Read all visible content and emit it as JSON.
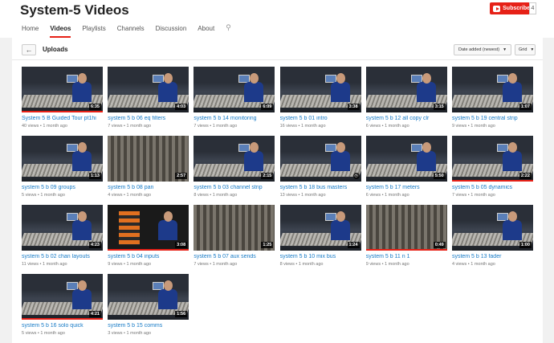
{
  "channel": {
    "title": "System-5 Videos",
    "subscribe_label": "Subscribe",
    "subscriber_count": "4"
  },
  "tabs": [
    {
      "label": "Home",
      "active": false
    },
    {
      "label": "Videos",
      "active": true
    },
    {
      "label": "Playlists",
      "active": false
    },
    {
      "label": "Channels",
      "active": false
    },
    {
      "label": "Discussion",
      "active": false
    },
    {
      "label": "About",
      "active": false
    }
  ],
  "toolbar": {
    "back_icon": "←",
    "section_title": "Uploads",
    "sort_label": "Date added (newest)",
    "view_label": "Grid"
  },
  "colors": {
    "accent": "#e62117",
    "link": "#167ac6"
  },
  "videos": [
    {
      "title": "System 5 B Guided Tour pt1hi",
      "views": "40 views",
      "age": "1 month ago",
      "duration": "6:35",
      "watched": 1.0,
      "style": "v1"
    },
    {
      "title": "system 5 b 06 eq filters",
      "views": "7 views",
      "age": "1 month ago",
      "duration": "4:03",
      "watched": 0,
      "style": "v1"
    },
    {
      "title": "system 5 b 14 monitoring",
      "views": "7 views",
      "age": "1 month ago",
      "duration": "6:09",
      "watched": 0,
      "style": "v1"
    },
    {
      "title": "system 5 b 01 intro",
      "views": "16 views",
      "age": "1 month ago",
      "duration": "3:38",
      "watched": 0,
      "style": "v1"
    },
    {
      "title": "system 5 b 12 all copy clr",
      "views": "6 views",
      "age": "1 month ago",
      "duration": "3:15",
      "watched": 0,
      "style": "v1"
    },
    {
      "title": "system 5 b 19 central strip",
      "views": "9 views",
      "age": "1 month ago",
      "duration": "1:07",
      "watched": 0,
      "style": "v1"
    },
    {
      "title": "system 5 b 09 groups",
      "views": "5 views",
      "age": "1 month ago",
      "duration": "1:13",
      "watched": 0,
      "style": "v1"
    },
    {
      "title": "system 5 b 08 pan",
      "views": "4 views",
      "age": "1 month ago",
      "duration": "2:57",
      "watched": 0,
      "style": "v2"
    },
    {
      "title": "system 5 b 03 channel strip",
      "views": "8 views",
      "age": "1 month ago",
      "duration": "2:15",
      "watched": 0,
      "style": "v1"
    },
    {
      "title": "system 5 b 18 bus masters",
      "views": "13 views",
      "age": "1 month ago",
      "duration": "",
      "watched": 0,
      "style": "v1"
    },
    {
      "title": "system 5 b 17 meters",
      "views": "6 views",
      "age": "1 month ago",
      "duration": "5:50",
      "watched": 0,
      "style": "v1"
    },
    {
      "title": "system 5 b 05 dynamics",
      "views": "7 views",
      "age": "1 month ago",
      "duration": "2:22",
      "watched": 1.0,
      "style": "v1"
    },
    {
      "title": "system 5 b 02 chan layouts",
      "views": "11 views",
      "age": "1 month ago",
      "duration": "4:23",
      "watched": 0,
      "style": "v1"
    },
    {
      "title": "system 5 b 04 inputs",
      "views": "9 views",
      "age": "1 month ago",
      "duration": "3:08",
      "watched": 1.0,
      "style": "v3"
    },
    {
      "title": "system 5 b 07 aux sends",
      "views": "7 views",
      "age": "1 month ago",
      "duration": "1:25",
      "watched": 0,
      "style": "v2"
    },
    {
      "title": "system 5 b 10 mix bus",
      "views": "8 views",
      "age": "1 month ago",
      "duration": "1:24",
      "watched": 0,
      "style": "v1"
    },
    {
      "title": "system 5 b 11 n 1",
      "views": "9 views",
      "age": "1 month ago",
      "duration": "0:49",
      "watched": 1.0,
      "style": "v2"
    },
    {
      "title": "system 5 b 13 fader",
      "views": "4 views",
      "age": "1 month ago",
      "duration": "1:00",
      "watched": 0,
      "style": "v1"
    },
    {
      "title": "system 5 b 16 solo quick",
      "views": "5 views",
      "age": "1 month ago",
      "duration": "4:21",
      "watched": 1.0,
      "style": "v1"
    },
    {
      "title": "system 5 b 15 comms",
      "views": "3 views",
      "age": "1 month ago",
      "duration": "1:56",
      "watched": 0,
      "style": "v1"
    }
  ]
}
